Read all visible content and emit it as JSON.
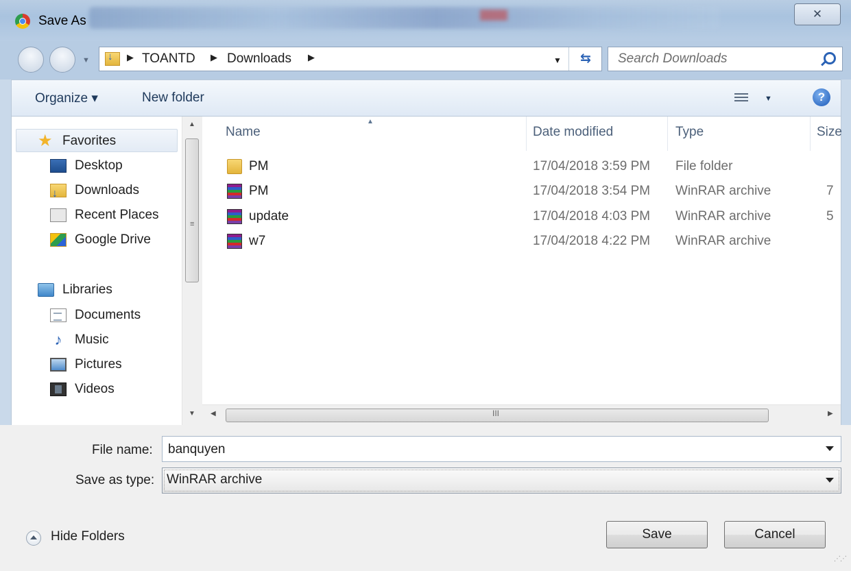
{
  "window": {
    "title": "Save As",
    "close_glyph": "✕"
  },
  "address": {
    "crumbs": [
      "TOANTD",
      "Downloads"
    ],
    "search_placeholder": "Search Downloads"
  },
  "toolbar": {
    "organize_label": "Organize ▾",
    "new_folder_label": "New folder"
  },
  "nav": {
    "favorites": "Favorites",
    "favorites_items": [
      "Desktop",
      "Downloads",
      "Recent Places",
      "Google Drive"
    ],
    "libraries": "Libraries",
    "libraries_items": [
      "Documents",
      "Music",
      "Pictures",
      "Videos"
    ]
  },
  "columns": {
    "name": "Name",
    "date": "Date modified",
    "type": "Type",
    "size": "Size"
  },
  "files": [
    {
      "name": "PM",
      "date": "17/04/2018 3:59 PM",
      "type": "File folder",
      "size": "",
      "icon": "folder-icon"
    },
    {
      "name": "PM",
      "date": "17/04/2018 3:54 PM",
      "type": "WinRAR archive",
      "size": "7",
      "icon": "winrar-archive-icon"
    },
    {
      "name": "update",
      "date": "17/04/2018 4:03 PM",
      "type": "WinRAR archive",
      "size": "5",
      "icon": "winrar-archive-icon"
    },
    {
      "name": "w7",
      "date": "17/04/2018 4:22 PM",
      "type": "WinRAR archive",
      "size": "",
      "icon": "winrar-archive-icon"
    }
  ],
  "form": {
    "file_name_label": "File name:",
    "file_name_value": "banquyen",
    "save_type_label": "Save as type:",
    "save_type_value": "WinRAR archive"
  },
  "footer": {
    "hide_folders_label": "Hide Folders",
    "save_label": "Save",
    "cancel_label": "Cancel"
  },
  "colors": {
    "accent": "#2a62b5",
    "title_bar": "#b9cde3",
    "selected": "#e3ebf5"
  }
}
